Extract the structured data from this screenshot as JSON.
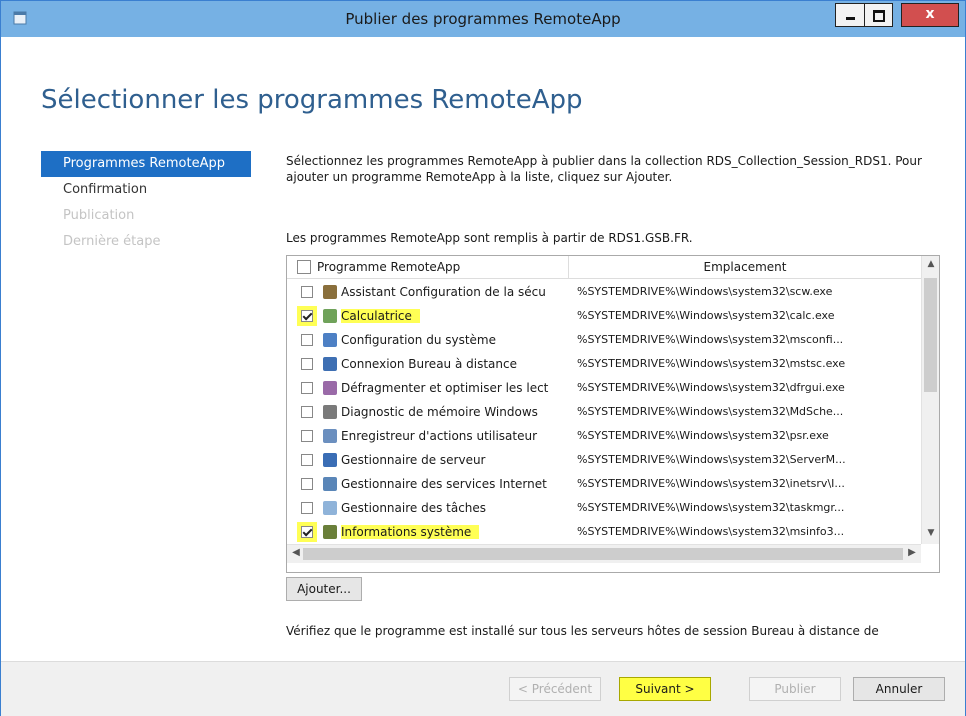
{
  "window": {
    "title": "Publier des programmes RemoteApp",
    "close_glyph": "x"
  },
  "page": {
    "heading": "Sélectionner les programmes RemoteApp",
    "description": "Sélectionnez les programmes RemoteApp à publier dans la collection RDS_Collection_Session_RDS1. Pour ajouter un programme RemoteApp à la liste, cliquez sur Ajouter.",
    "source_text": "Les programmes RemoteApp sont remplis à partir de RDS1.GSB.FR.",
    "footer_note": "Vérifiez que le programme est installé sur tous les serveurs hôtes de session Bureau à distance de"
  },
  "nav": {
    "items": [
      {
        "label": "Programmes RemoteApp"
      },
      {
        "label": "Confirmation"
      },
      {
        "label": "Publication"
      },
      {
        "label": "Dernière étape"
      }
    ]
  },
  "list": {
    "col_name": "Programme RemoteApp",
    "col_location": "Emplacement",
    "rows": [
      {
        "name": "Assistant Configuration de la sécu",
        "location": "%SYSTEMDRIVE%\\Windows\\system32\\scw.exe"
      },
      {
        "name": "Calculatrice",
        "location": "%SYSTEMDRIVE%\\Windows\\system32\\calc.exe"
      },
      {
        "name": "Configuration du système",
        "location": "%SYSTEMDRIVE%\\Windows\\system32\\msconfi..."
      },
      {
        "name": "Connexion Bureau à distance",
        "location": "%SYSTEMDRIVE%\\Windows\\system32\\mstsc.exe"
      },
      {
        "name": "Défragmenter et optimiser les lect",
        "location": "%SYSTEMDRIVE%\\Windows\\system32\\dfrgui.exe"
      },
      {
        "name": "Diagnostic de mémoire Windows",
        "location": "%SYSTEMDRIVE%\\Windows\\system32\\MdSche..."
      },
      {
        "name": "Enregistreur d'actions utilisateur",
        "location": "%SYSTEMDRIVE%\\Windows\\system32\\psr.exe"
      },
      {
        "name": "Gestionnaire de serveur",
        "location": "%SYSTEMDRIVE%\\Windows\\system32\\ServerM..."
      },
      {
        "name": "Gestionnaire des services Internet",
        "location": "%SYSTEMDRIVE%\\Windows\\system32\\inetsrv\\I..."
      },
      {
        "name": "Gestionnaire des tâches",
        "location": "%SYSTEMDRIVE%\\Windows\\system32\\taskmgr..."
      },
      {
        "name": "Informations système",
        "location": "%SYSTEMDRIVE%\\Windows\\system32\\msinfo3..."
      }
    ]
  },
  "buttons": {
    "add": "Ajouter...",
    "previous": "< Précédent",
    "next": "Suivant >",
    "publish": "Publier",
    "cancel": "Annuler"
  }
}
